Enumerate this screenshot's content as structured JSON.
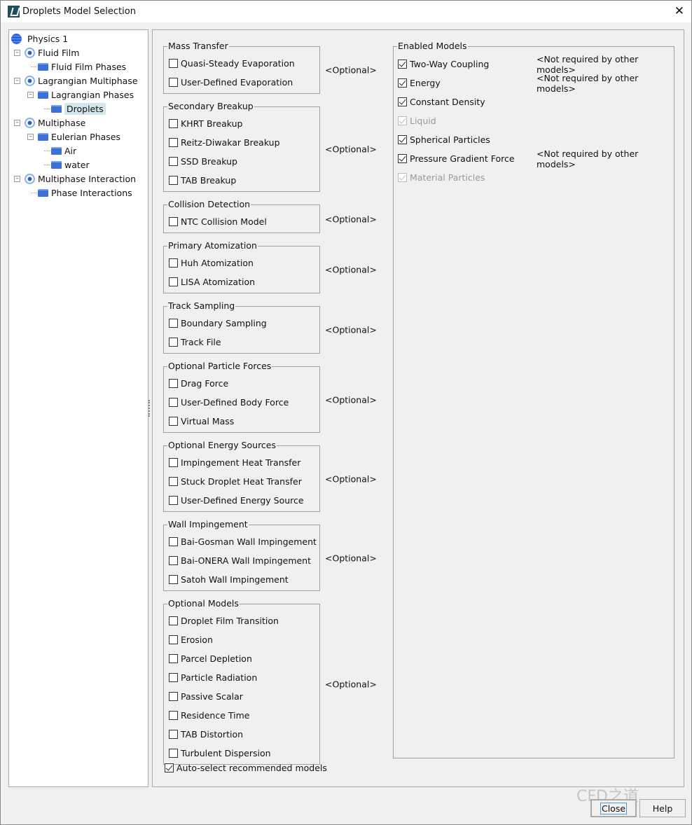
{
  "window": {
    "title": "Droplets Model Selection"
  },
  "tree": [
    {
      "label": "Physics 1",
      "icon": "physics-icon",
      "level": 0
    },
    {
      "label": "Fluid Film",
      "icon": "continuum-icon",
      "level": 1,
      "expander": "minus"
    },
    {
      "label": "Fluid Film Phases",
      "icon": "folder-icon",
      "level": 2
    },
    {
      "label": "Lagrangian Multiphase",
      "icon": "continuum-icon",
      "level": 1,
      "expander": "minus"
    },
    {
      "label": "Lagrangian Phases",
      "icon": "folder-icon",
      "level": 2,
      "expander": "minus"
    },
    {
      "label": "Droplets",
      "icon": "folder-icon",
      "level": 3,
      "selected": true
    },
    {
      "label": "Multiphase",
      "icon": "continuum-icon",
      "level": 1,
      "expander": "minus"
    },
    {
      "label": "Eulerian Phases",
      "icon": "folder-icon",
      "level": 2,
      "expander": "minus"
    },
    {
      "label": "Air",
      "icon": "folder-icon",
      "level": 3
    },
    {
      "label": "water",
      "icon": "folder-icon",
      "level": 3
    },
    {
      "label": "Multiphase Interaction",
      "icon": "continuum-icon",
      "level": 1,
      "expander": "minus"
    },
    {
      "label": "Phase Interactions",
      "icon": "folder-icon",
      "level": 2
    }
  ],
  "optional_label": "<Optional>",
  "groups": [
    {
      "title": "Mass Transfer",
      "items": [
        "Quasi-Steady Evaporation",
        "User-Defined Evaporation"
      ]
    },
    {
      "title": "Secondary Breakup",
      "items": [
        "KHRT Breakup",
        "Reitz-Diwakar Breakup",
        "SSD Breakup",
        "TAB Breakup"
      ]
    },
    {
      "title": "Collision Detection",
      "items": [
        "NTC Collision Model"
      ]
    },
    {
      "title": "Primary Atomization",
      "items": [
        "Huh Atomization",
        "LISA Atomization"
      ]
    },
    {
      "title": "Track Sampling",
      "items": [
        "Boundary Sampling",
        "Track File"
      ]
    },
    {
      "title": "Optional Particle Forces",
      "items": [
        "Drag Force",
        "User-Defined Body Force",
        "Virtual Mass"
      ]
    },
    {
      "title": "Optional Energy Sources",
      "items": [
        "Impingement Heat Transfer",
        "Stuck Droplet Heat Transfer",
        "User-Defined Energy Source"
      ]
    },
    {
      "title": "Wall Impingement",
      "items": [
        "Bai-Gosman Wall Impingement",
        "Bai-ONERA Wall Impingement",
        "Satoh Wall Impingement"
      ]
    },
    {
      "title": "Optional Models",
      "items": [
        "Droplet Film Transition",
        "Erosion",
        "Parcel Depletion",
        "Particle Radiation",
        "Passive Scalar",
        "Residence Time",
        "TAB Distortion",
        "Turbulent Dispersion"
      ]
    }
  ],
  "enabled": {
    "title": "Enabled Models",
    "items": [
      {
        "label": "Two-Way Coupling",
        "checked": true,
        "disabled": false,
        "note": "<Not required by other models>"
      },
      {
        "label": "Energy",
        "checked": true,
        "disabled": false,
        "note": "<Not required by other models>"
      },
      {
        "label": "Constant Density",
        "checked": true,
        "disabled": false,
        "note": ""
      },
      {
        "label": "Liquid",
        "checked": true,
        "disabled": true,
        "note": ""
      },
      {
        "label": "Spherical Particles",
        "checked": true,
        "disabled": false,
        "note": ""
      },
      {
        "label": "Pressure Gradient Force",
        "checked": true,
        "disabled": false,
        "note": "<Not required by other models>"
      },
      {
        "label": "Material Particles",
        "checked": true,
        "disabled": true,
        "note": ""
      }
    ]
  },
  "auto_select": {
    "label": "Auto-select recommended models",
    "checked": true
  },
  "buttons": {
    "close": "Close",
    "help": "Help"
  },
  "watermark": "CFD之道"
}
